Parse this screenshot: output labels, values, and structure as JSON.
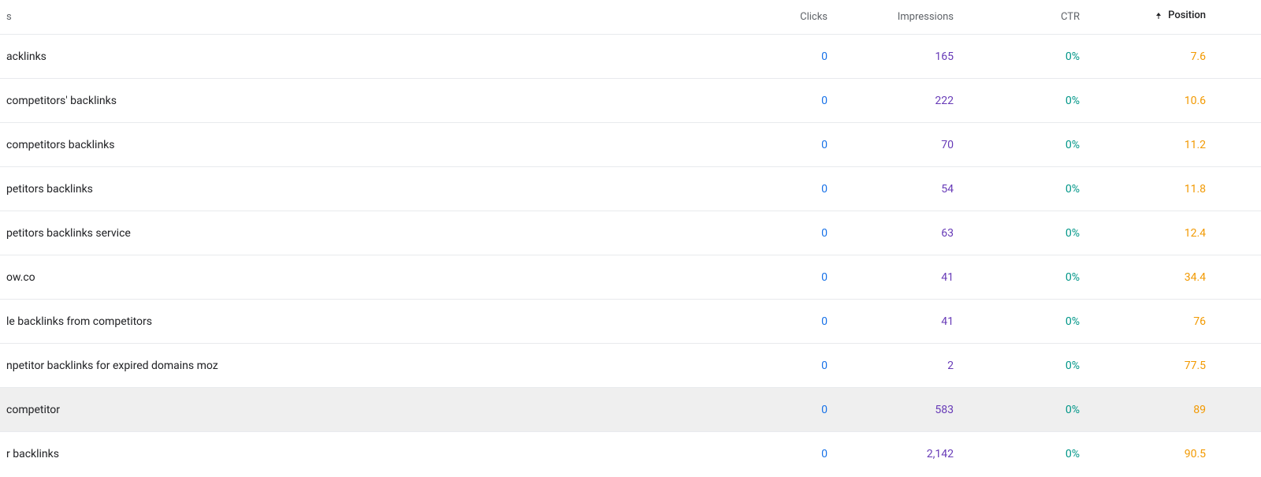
{
  "header": {
    "query_col": "s",
    "clicks": "Clicks",
    "impressions": "Impressions",
    "ctr": "CTR",
    "position": "Position",
    "sort_dir": "asc"
  },
  "rows": [
    {
      "query": "acklinks",
      "clicks": "0",
      "impressions": "165",
      "ctr": "0%",
      "position": "7.6",
      "highlight": false
    },
    {
      "query": "competitors' backlinks",
      "clicks": "0",
      "impressions": "222",
      "ctr": "0%",
      "position": "10.6",
      "highlight": false
    },
    {
      "query": "competitors backlinks",
      "clicks": "0",
      "impressions": "70",
      "ctr": "0%",
      "position": "11.2",
      "highlight": false
    },
    {
      "query": "petitors backlinks",
      "clicks": "0",
      "impressions": "54",
      "ctr": "0%",
      "position": "11.8",
      "highlight": false
    },
    {
      "query": "petitors backlinks service",
      "clicks": "0",
      "impressions": "63",
      "ctr": "0%",
      "position": "12.4",
      "highlight": false
    },
    {
      "query": "ow.co",
      "clicks": "0",
      "impressions": "41",
      "ctr": "0%",
      "position": "34.4",
      "highlight": false
    },
    {
      "query": "le backlinks from competitors",
      "clicks": "0",
      "impressions": "41",
      "ctr": "0%",
      "position": "76",
      "highlight": false
    },
    {
      "query": "npetitor backlinks for expired domains moz",
      "clicks": "0",
      "impressions": "2",
      "ctr": "0%",
      "position": "77.5",
      "highlight": false
    },
    {
      "query": "competitor",
      "clicks": "0",
      "impressions": "583",
      "ctr": "0%",
      "position": "89",
      "highlight": true
    },
    {
      "query": "r backlinks",
      "clicks": "0",
      "impressions": "2,142",
      "ctr": "0%",
      "position": "90.5",
      "highlight": false
    }
  ]
}
